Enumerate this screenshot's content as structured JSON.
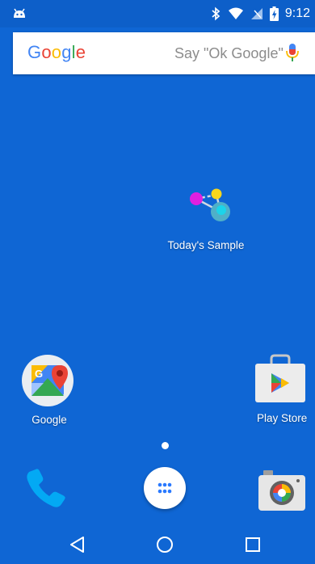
{
  "status_bar": {
    "time": "9:12",
    "icons": [
      "android-debug-icon",
      "bluetooth-icon",
      "wifi-icon",
      "no-sim-icon",
      "battery-charging-icon"
    ]
  },
  "search_bar": {
    "logo_text": "Google",
    "placeholder": "Say \"Ok Google\"",
    "mic_icon": "mic-icon"
  },
  "home": {
    "apps": [
      {
        "label": "Today's Sample",
        "icon": "molecule-icon"
      },
      {
        "label": "Google",
        "icon": "google-maps-icon"
      },
      {
        "label": "Play Store",
        "icon": "play-store-icon"
      }
    ]
  },
  "dock": {
    "items": [
      "phone-icon",
      "app-drawer-icon",
      "camera-icon"
    ]
  },
  "nav": {
    "items": [
      "back-icon",
      "home-icon",
      "recents-icon"
    ]
  },
  "colors": {
    "wallpaper": "#0f66d4",
    "status_bar": "#0d5fc9",
    "google_blue": "#4285F4",
    "google_red": "#EA4335",
    "google_yellow": "#FBBC05",
    "google_green": "#34A853"
  }
}
